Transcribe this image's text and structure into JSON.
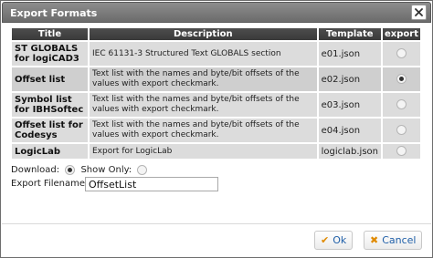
{
  "dialog": {
    "title": "Export Formats",
    "close_icon": "close-icon"
  },
  "table": {
    "headers": [
      "Title",
      "Description",
      "Template",
      "export"
    ],
    "rows": [
      {
        "title": "ST GLOBALS for logiCAD3",
        "description": "IEC 61131-3 Structured Text GLOBALS section",
        "template": "e01.json",
        "export": false
      },
      {
        "title": "Offset list",
        "description": "Text list with the names and byte/bit offsets of the values with export checkmark.",
        "template": "e02.json",
        "export": true
      },
      {
        "title": "Symbol list for IBHSoftec",
        "description": "Text list with the names and byte/bit offsets of the values with export checkmark.",
        "template": "e03.json",
        "export": false
      },
      {
        "title": "Offset list for Codesys",
        "description": "Text list with the names and byte/bit offsets of the values with export checkmark.",
        "template": "e04.json",
        "export": false
      },
      {
        "title": "LogicLab",
        "description": "Export for LogicLab",
        "template": "logiclab.json",
        "export": false
      }
    ]
  },
  "options": {
    "download_label": "Download:",
    "download_selected": true,
    "show_only_label": "Show Only:",
    "show_only_selected": false,
    "filename_label": "Export Filename:",
    "filename_value": "OffsetList"
  },
  "buttons": {
    "ok_label": "Ok",
    "cancel_label": "Cancel"
  },
  "colors": {
    "titlebar": "#7a7a7a",
    "header": "#444444",
    "row": "#dcdcdc",
    "button_text": "#1f5fa8",
    "button_icon": "#e08a00"
  }
}
